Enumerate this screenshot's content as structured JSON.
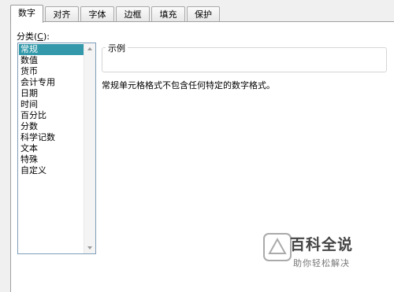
{
  "tabs": [
    {
      "label": "数字",
      "active": true
    },
    {
      "label": "对齐",
      "active": false
    },
    {
      "label": "字体",
      "active": false
    },
    {
      "label": "边框",
      "active": false
    },
    {
      "label": "填充",
      "active": false
    },
    {
      "label": "保护",
      "active": false
    }
  ],
  "category": {
    "label_prefix": "分类(",
    "label_hotkey": "C",
    "label_suffix": "):",
    "items": [
      "常规",
      "数值",
      "货币",
      "会计专用",
      "日期",
      "时间",
      "百分比",
      "分数",
      "科学记数",
      "文本",
      "特殊",
      "自定义"
    ],
    "selected": "常规"
  },
  "sample": {
    "label": "示例",
    "value": ""
  },
  "description": "常规单元格格式不包含任何特定的数字格式。",
  "watermark": {
    "title": "百科全说",
    "subtitle": "助你轻松解决"
  },
  "colors": {
    "selection": "#3399aa",
    "panel": "#ffffff",
    "dialog": "#f0f0f0"
  }
}
